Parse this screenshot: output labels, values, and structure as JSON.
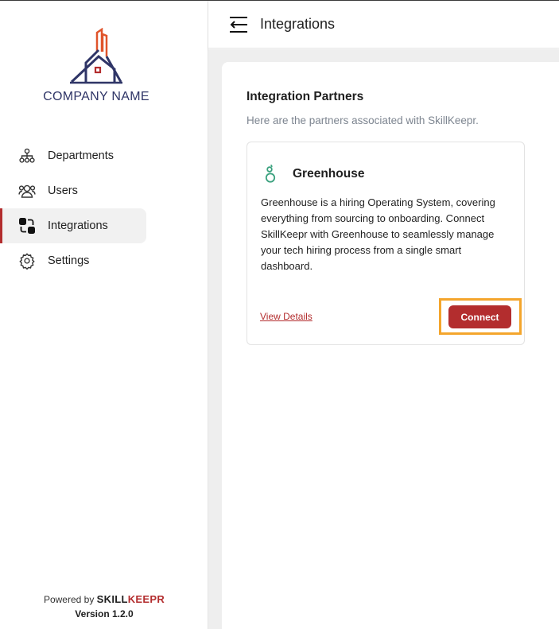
{
  "company": {
    "name": "COMPANY NAME"
  },
  "sidebar": {
    "items": [
      {
        "label": "Departments",
        "icon": "org-chart-icon",
        "active": false
      },
      {
        "label": "Users",
        "icon": "users-icon",
        "active": false
      },
      {
        "label": "Integrations",
        "icon": "integrations-icon",
        "active": true
      },
      {
        "label": "Settings",
        "icon": "gear-icon",
        "active": false
      }
    ]
  },
  "footer": {
    "powered_by": "Powered by",
    "brand_part1": "SKILL",
    "brand_part2": "KEEPR",
    "version": "Version 1.2.0"
  },
  "header": {
    "title": "Integrations",
    "menu_icon": "collapse-menu-icon"
  },
  "main": {
    "title": "Integration Partners",
    "subtitle": "Here are the partners associated with SkillKeepr.",
    "cards": [
      {
        "name": "Greenhouse",
        "icon": "greenhouse-logo-icon",
        "description": "Greenhouse is a hiring Operating System, covering everything from sourcing to onboarding. Connect SkillKeepr with Greenhouse to seamlessly manage your tech hiring process from a single smart dashboard.",
        "view_details": "View Details",
        "connect": "Connect"
      }
    ]
  },
  "colors": {
    "accent": "#b32d2e",
    "highlight": "#f4a52c",
    "logo_navy": "#2f3567",
    "logo_orange": "#e0542b",
    "greenhouse_green": "#3aa17e"
  }
}
